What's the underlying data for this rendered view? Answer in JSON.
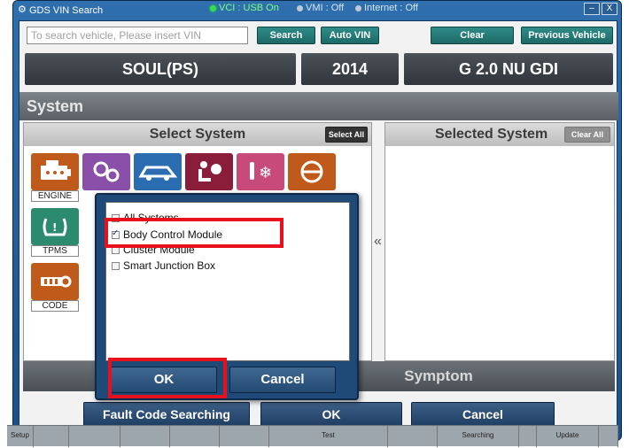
{
  "window": {
    "title": "GDS VIN Search",
    "status": [
      {
        "label": "VCI : USB On",
        "state": "on"
      },
      {
        "label": "VMI : Off",
        "state": "off"
      },
      {
        "label": "Internet : Off",
        "state": "off"
      }
    ],
    "controls": {
      "minimize": "–",
      "close": "X"
    }
  },
  "search": {
    "placeholder": "To search vehicle, Please insert VIN",
    "value": "",
    "search_label": "Search",
    "auto_vin_label": "Auto VIN",
    "clear_label": "Clear",
    "previous_label": "Previous Vehicle"
  },
  "vehicle": {
    "model": "SOUL(PS)",
    "year": "2014",
    "engine": "G 2.0 NU GDI"
  },
  "system": {
    "header": "System",
    "select_title": "Select System",
    "select_all_label": "Select All",
    "selected_title": "Selected System",
    "clear_all_label": "Clear All",
    "collapse_arrow": "«",
    "icons": [
      {
        "name": "engine-icon",
        "label": "ENGINE",
        "color": "#c05a1a"
      },
      {
        "name": "transmission-icon",
        "label": "",
        "color": "#8a4fa8"
      },
      {
        "name": "vehicle-body-icon",
        "label": "",
        "color": "#2a6db0"
      },
      {
        "name": "seat-airbag-icon",
        "label": "",
        "color": "#8a1d3a"
      },
      {
        "name": "climate-icon",
        "label": "",
        "color": "#c84a7a"
      },
      {
        "name": "steering-icon",
        "label": "",
        "color": "#c05a1a"
      },
      {
        "name": "tpms-icon",
        "label": "TPMS",
        "color": "#2c8a6e"
      },
      {
        "name": "code-icon",
        "label": "CODE",
        "color": "#c05a1a"
      }
    ]
  },
  "symptom": {
    "label": "Symptom"
  },
  "footer": {
    "fault_code_label": "Fault Code Searching",
    "ok_label": "OK",
    "cancel_label": "Cancel"
  },
  "taskbar": {
    "cells": [
      "Setup",
      "",
      "",
      "",
      "",
      "",
      "Test",
      "",
      "Searching",
      "",
      "Update",
      ""
    ]
  },
  "dialog": {
    "items": [
      {
        "label": "All Systems",
        "checked": false
      },
      {
        "label": "Body Control Module",
        "checked": true
      },
      {
        "label": "Cluster Module",
        "checked": false
      },
      {
        "label": "Smart Junction Box",
        "checked": false
      }
    ],
    "ok_label": "OK",
    "cancel_label": "Cancel"
  },
  "highlight_color": "#e8101c"
}
